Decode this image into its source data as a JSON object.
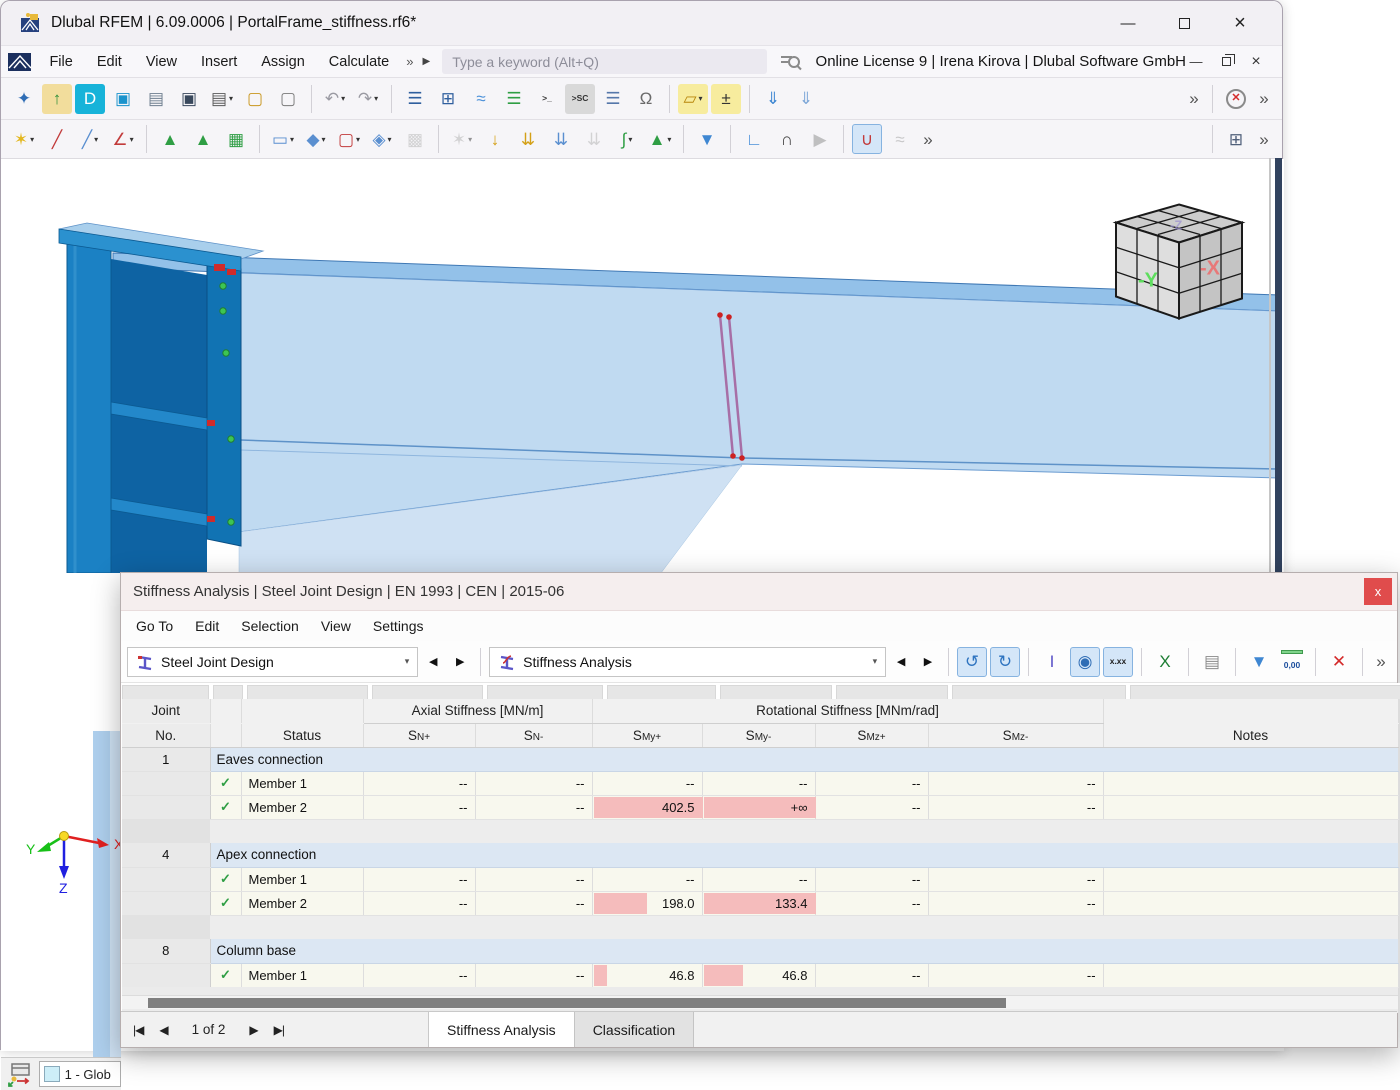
{
  "window": {
    "title": "Dlubal RFEM | 6.09.0006 | PortalFrame_stiffness.rf6*",
    "controls": {
      "minimize": "—",
      "close": "×"
    }
  },
  "menubar": {
    "items": [
      "File",
      "Edit",
      "View",
      "Insert",
      "Assign",
      "Calculate"
    ],
    "overflow": "»",
    "expand": "▶",
    "search_placeholder": "Type a keyword (Alt+Q)",
    "license": "Online License 9 | Irena Kirova | Dlubal Software GmbH",
    "mdi": {
      "minimize": "—",
      "close": "×"
    }
  },
  "toolbar_main": {
    "icons": [
      {
        "n": "new-model-icon",
        "g": "✦",
        "c": "#2f6db5"
      },
      {
        "n": "open-model-icon",
        "g": "↑",
        "c": "#2f8f3a",
        "bg": "#f2dd9c"
      },
      {
        "n": "dlubal-connect-icon",
        "g": "D",
        "c": "#ffffff",
        "bg": "#17b3d9"
      },
      {
        "n": "model-cube-icon",
        "g": "▣",
        "c": "#1a93cc"
      },
      {
        "n": "edit-model-data-icon",
        "g": "▤",
        "c": "#6f7f8f"
      },
      {
        "n": "save-icon",
        "g": "▣",
        "c": "#39485c"
      },
      {
        "n": "print-icon",
        "g": "▤",
        "c": "#5a5a5a",
        "d": 1
      },
      {
        "n": "new-printout-report-icon",
        "g": "▢",
        "c": "#c9971f"
      },
      {
        "n": "printout-report-icon",
        "g": "▢",
        "c": "#7a7a7a"
      },
      {
        "sep": 1
      },
      {
        "n": "undo-icon",
        "g": "↶",
        "c": "#9a9aa2",
        "d": 1
      },
      {
        "n": "redo-icon",
        "g": "↷",
        "c": "#9a9aa2",
        "d": 1
      },
      {
        "sep": 1
      },
      {
        "n": "data-navigator-icon",
        "g": "☰",
        "c": "#2f5f9e"
      },
      {
        "n": "tables-icon",
        "g": "⊞",
        "c": "#2f5f9e"
      },
      {
        "n": "result-diagram-icon",
        "g": "≈",
        "c": "#4a90d9"
      },
      {
        "n": "display-navigator-icon",
        "g": "☰",
        "c": "#2f9e44"
      },
      {
        "n": "console-icon",
        "g": ">_",
        "c": "#333333",
        "txt": 1
      },
      {
        "n": "script-icon",
        "g": ">SC",
        "c": "#333333",
        "txt": 1,
        "bg": "#d9d9d9"
      },
      {
        "n": "views-navigator-icon",
        "g": "☰",
        "c": "#5577aa"
      },
      {
        "n": "support-center-icon",
        "g": "Ω",
        "c": "#6a6a6a"
      },
      {
        "sep": 1
      },
      {
        "n": "edit-surface-icon",
        "g": "▱",
        "c": "#b8860b",
        "bg": "#f7ec9e",
        "d": 1
      },
      {
        "n": "add-remove-objects-icon",
        "g": "±",
        "c": "#333333",
        "bg": "#f7ec9e"
      },
      {
        "sep": 1
      },
      {
        "n": "insert-object-icon",
        "g": "⇓",
        "c": "#3f87d2"
      },
      {
        "n": "paste-object-icon",
        "g": "⇓",
        "c": "#7fa8d8"
      },
      {
        "spacer": 1
      },
      {
        "n": "toolbar-overflow-icon",
        "g": "»",
        "c": "#555555",
        "plain": 1
      },
      {
        "sep": 1
      },
      {
        "n": "zoom-cancel-icon",
        "g": "✕",
        "c": "#d42b2b",
        "ring": 1
      },
      {
        "n": "toolbar-overflow-2-icon",
        "g": "»",
        "c": "#555555",
        "plain": 1
      }
    ]
  },
  "toolbar_insert": {
    "icons": [
      {
        "n": "new-node-icon",
        "g": "✶",
        "c": "#e3b71e",
        "d": 1
      },
      {
        "n": "new-line-icon",
        "g": "╱",
        "c": "#c23b3b"
      },
      {
        "n": "new-member-icon",
        "g": "╱",
        "c": "#5a8fd0",
        "d": 1
      },
      {
        "n": "new-polyline-icon",
        "g": "∠",
        "c": "#c23b3b",
        "d": 1
      },
      {
        "sep": 1
      },
      {
        "n": "nodal-support-icon",
        "g": "▲",
        "c": "#2f9e44"
      },
      {
        "n": "line-support-icon",
        "g": "▲",
        "c": "#2f9e44"
      },
      {
        "n": "surface-support-icon",
        "g": "▦",
        "c": "#2f9e44"
      },
      {
        "sep": 1
      },
      {
        "n": "new-surface-icon",
        "g": "▭",
        "c": "#5a8fd0",
        "d": 1
      },
      {
        "n": "new-solid-icon",
        "g": "◆",
        "c": "#5a8fd0",
        "d": 1
      },
      {
        "n": "new-opening-icon",
        "g": "▢",
        "c": "#c23b3b",
        "d": 1
      },
      {
        "n": "new-nurbs-icon",
        "g": "◈",
        "c": "#5a8fd0",
        "d": 1
      },
      {
        "n": "copy-model-icon",
        "g": "▩",
        "c": "#b0b0b0",
        "gray": 1
      },
      {
        "sep": 1
      },
      {
        "n": "edit-node-icon",
        "g": "✶",
        "c": "#b0b0b0",
        "gray": 1,
        "d": 1
      },
      {
        "n": "nodal-load-icon",
        "g": "↓",
        "c": "#d4a017"
      },
      {
        "n": "member-load-icon",
        "g": "⇊",
        "c": "#d4a017"
      },
      {
        "n": "line-load-icon",
        "g": "⇊",
        "c": "#5a8fd0"
      },
      {
        "n": "solid-load-icon",
        "g": "⇊",
        "c": "#b0b0b0",
        "gray": 1
      },
      {
        "n": "imperfection-icon",
        "g": "∫",
        "c": "#2f9e44",
        "d": 1
      },
      {
        "n": "load-wizard-icon",
        "g": "▲",
        "c": "#2f9e44",
        "d": 1
      },
      {
        "sep": 1
      },
      {
        "n": "visibility-filter-icon",
        "g": "▼",
        "c": "#3f87d2"
      },
      {
        "sep": 1
      },
      {
        "n": "result-window-icon",
        "g": "∟",
        "c": "#4a90d9"
      },
      {
        "n": "section-icon",
        "g": "∩",
        "c": "#444444"
      },
      {
        "n": "animation-icon",
        "g": "▶",
        "c": "#8a8a8a",
        "gray": 1
      },
      {
        "sep": 1
      },
      {
        "n": "show-results-icon",
        "g": "∪",
        "c": "#c23b3b",
        "act": 1
      },
      {
        "n": "smooth-results-icon",
        "g": "≈",
        "c": "#9a9a9a",
        "gray": 1
      },
      {
        "n": "toolbar2-overflow-icon",
        "g": "»",
        "c": "#555555",
        "plain": 1
      },
      {
        "spacer": 1
      },
      {
        "sep": 1
      },
      {
        "n": "table-view-icon",
        "g": "⊞",
        "c": "#50607a"
      },
      {
        "n": "toolbar2-overflow-2-icon",
        "g": "»",
        "c": "#555555",
        "plain": 1
      }
    ]
  },
  "viewport": {
    "axes": {
      "x": "X",
      "y": "Y",
      "z": "Z"
    },
    "navcube": {
      "front": "-Y",
      "right": "-X",
      "top": "-Z"
    },
    "status_item": "1 - Glob"
  },
  "dialog": {
    "title": "Stiffness Analysis | Steel Joint Design | EN 1993 | CEN | 2015-06",
    "close_glyph": "x",
    "menu": [
      "Go To",
      "Edit",
      "Selection",
      "View",
      "Settings"
    ],
    "combos": {
      "design_case": "Steel Joint Design",
      "result_view": "Stiffness Analysis",
      "chevron": "▾",
      "prev": "◀",
      "next": "▶"
    },
    "toolbar": {
      "icons": [
        {
          "n": "previous-result-icon",
          "g": "↺",
          "c": "#2f74c0",
          "act": 1
        },
        {
          "n": "next-result-icon",
          "g": "↻",
          "c": "#2f74c0",
          "act": 1
        },
        {
          "sep": 1
        },
        {
          "n": "design-check-details-icon",
          "g": "I",
          "c": "#5b55c8"
        },
        {
          "n": "show-values-icon",
          "g": "◉",
          "c": "#2f6db5",
          "act": 1
        },
        {
          "n": "result-values-icon",
          "g": "x.xx",
          "c": "#222222",
          "act": 1,
          "txt": 1
        },
        {
          "sep": 1
        },
        {
          "n": "export-excel-icon",
          "g": "X",
          "c": "#1e7e34"
        },
        {
          "sep": 1
        },
        {
          "n": "add-to-report-icon",
          "g": "▤",
          "c": "#8a8a8a"
        },
        {
          "sep": 1
        },
        {
          "n": "filter-results-icon",
          "g": "▼",
          "c": "#3f87d2"
        },
        {
          "n": "decimal-places-icon",
          "g": "0,00",
          "c": "#1d4f9e",
          "txt": 1,
          "ruler": 1
        },
        {
          "sep": 1
        },
        {
          "n": "deselect-icon",
          "g": "✕",
          "c": "#d42b2b"
        },
        {
          "sep": 1
        },
        {
          "n": "dialog-toolbar-overflow-icon",
          "g": "»",
          "c": "#555555",
          "plain": 1
        }
      ]
    },
    "table": {
      "joint_header": {
        "line1": "Joint",
        "line2": "No."
      },
      "status_header": "Status",
      "notes_header": "Notes",
      "group_headers": {
        "axial": "Axial Stiffness [MN/m]",
        "rotational": "Rotational Stiffness [MNm/rad]"
      },
      "sub_headers": [
        {
          "b": "S",
          "s": "N+"
        },
        {
          "b": "S",
          "s": "N-"
        },
        {
          "b": "S",
          "s": "My+"
        },
        {
          "b": "S",
          "s": "My-"
        },
        {
          "b": "S",
          "s": "Mz+"
        },
        {
          "b": "S",
          "s": "Mz-"
        }
      ],
      "groups": [
        {
          "no": "1",
          "name": "Eaves connection",
          "members": [
            {
              "check": "✓",
              "name": "Member 1",
              "notes": "",
              "values": [
                {
                  "t": "--"
                },
                {
                  "t": "--"
                },
                {
                  "t": "--"
                },
                {
                  "t": "--"
                },
                {
                  "t": "--"
                },
                {
                  "t": "--"
                }
              ]
            },
            {
              "check": "✓",
              "name": "Member 2",
              "notes": "",
              "values": [
                {
                  "t": "--"
                },
                {
                  "t": "--"
                },
                {
                  "t": "402.5",
                  "bar": 1
                },
                {
                  "t": "+∞",
                  "bar": 1
                },
                {
                  "t": "--"
                },
                {
                  "t": "--"
                }
              ]
            }
          ]
        },
        {
          "no": "4",
          "name": "Apex connection",
          "members": [
            {
              "check": "✓",
              "name": "Member 1",
              "notes": "",
              "values": [
                {
                  "t": "--"
                },
                {
                  "t": "--"
                },
                {
                  "t": "--"
                },
                {
                  "t": "--"
                },
                {
                  "t": "--"
                },
                {
                  "t": "--"
                }
              ]
            },
            {
              "check": "✓",
              "name": "Member 2",
              "notes": "",
              "values": [
                {
                  "t": "--"
                },
                {
                  "t": "--"
                },
                {
                  "t": "198.0",
                  "bar": 0.49
                },
                {
                  "t": "133.4",
                  "bar": 1
                },
                {
                  "t": "--"
                },
                {
                  "t": "--"
                }
              ]
            }
          ]
        },
        {
          "no": "8",
          "name": "Column base",
          "members": [
            {
              "check": "✓",
              "name": "Member 1",
              "notes": "",
              "values": [
                {
                  "t": "--"
                },
                {
                  "t": "--"
                },
                {
                  "t": "46.8",
                  "bar": 0.12
                },
                {
                  "t": "46.8",
                  "bar": 0.35
                },
                {
                  "t": "--"
                },
                {
                  "t": "--"
                }
              ]
            }
          ]
        }
      ]
    },
    "footer": {
      "nav": [
        "|◀",
        "◀",
        "▶",
        "▶|"
      ],
      "page_label": "1 of 2",
      "tabs": [
        {
          "label": "Stiffness Analysis",
          "active": true
        },
        {
          "label": "Classification",
          "active": false
        }
      ]
    }
  }
}
